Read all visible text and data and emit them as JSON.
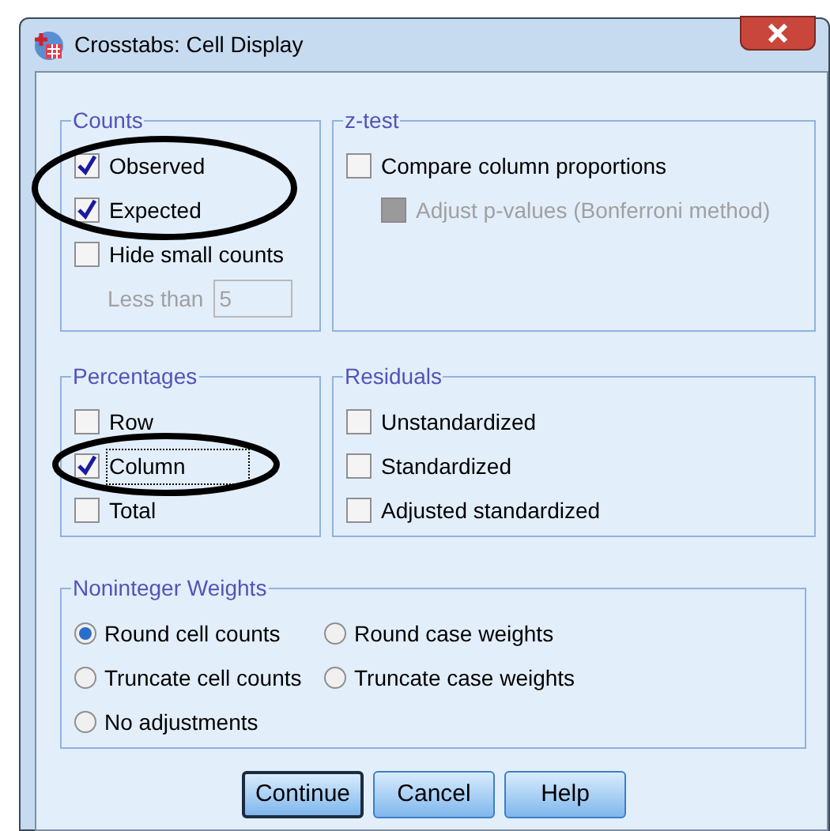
{
  "window": {
    "title": "Crosstabs: Cell Display"
  },
  "groups": [
    {
      "title": "Counts",
      "items": [
        {
          "kind": "checkbox",
          "label": "Observed",
          "checked": true,
          "disabled": false,
          "focused": false
        },
        {
          "kind": "checkbox",
          "label": "Expected",
          "checked": true,
          "disabled": false,
          "focused": false
        },
        {
          "kind": "checkbox",
          "label": "Hide small counts",
          "checked": false,
          "disabled": false,
          "focused": false
        },
        {
          "kind": "field",
          "label": "Less than",
          "value": "5",
          "disabled": true
        }
      ]
    },
    {
      "title": "z-test",
      "items": [
        {
          "kind": "checkbox",
          "label": "Compare column proportions",
          "checked": false,
          "disabled": false,
          "focused": false,
          "children": [
            {
              "kind": "checkbox",
              "label": "Adjust p-values (Bonferroni method)",
              "checked": false,
              "disabled": true,
              "focused": false
            }
          ]
        }
      ]
    },
    {
      "title": "Percentages",
      "items": [
        {
          "kind": "checkbox",
          "label": "Row",
          "checked": false,
          "disabled": false,
          "focused": false
        },
        {
          "kind": "checkbox",
          "label": "Column",
          "checked": true,
          "disabled": false,
          "focused": true
        },
        {
          "kind": "checkbox",
          "label": "Total",
          "checked": false,
          "disabled": false,
          "focused": false
        }
      ]
    },
    {
      "title": "Residuals",
      "items": [
        {
          "kind": "checkbox",
          "label": "Unstandardized",
          "checked": false,
          "disabled": false,
          "focused": false
        },
        {
          "kind": "checkbox",
          "label": "Standardized",
          "checked": false,
          "disabled": false,
          "focused": false
        },
        {
          "kind": "checkbox",
          "label": "Adjusted standardized",
          "checked": false,
          "disabled": false,
          "focused": false
        }
      ]
    }
  ],
  "noninteger_weights": {
    "title": "Noninteger Weights",
    "options": [
      {
        "label": "Round cell counts",
        "selected": true
      },
      {
        "label": "Round case weights",
        "selected": false
      },
      {
        "label": "Truncate cell counts",
        "selected": false
      },
      {
        "label": "Truncate case weights",
        "selected": false
      },
      {
        "label": "No adjustments",
        "selected": false
      }
    ]
  },
  "buttons": [
    {
      "label": "Continue",
      "default": true
    },
    {
      "label": "Cancel",
      "default": false
    },
    {
      "label": "Help",
      "default": false
    }
  ]
}
